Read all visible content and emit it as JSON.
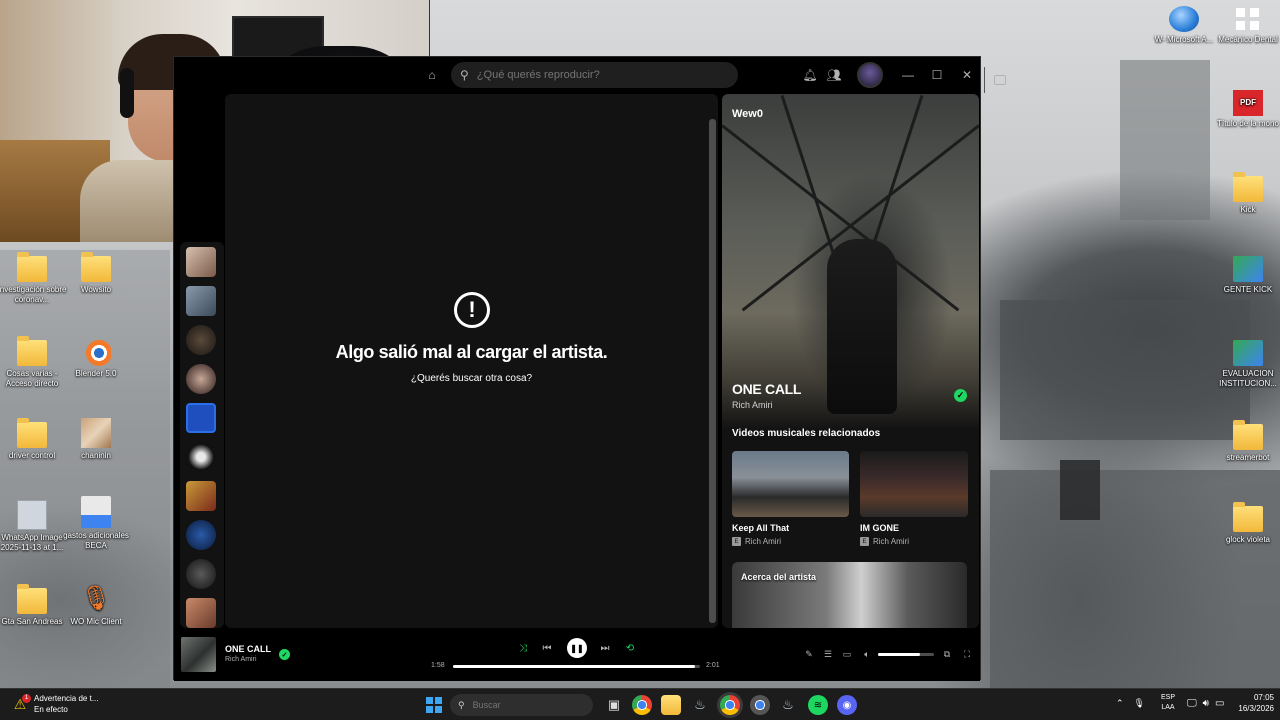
{
  "desktop": {
    "icons": [
      {
        "label": "Investigación sobre coronav..."
      },
      {
        "label": "Wowsito"
      },
      {
        "label": "Cosas varias - Acceso directo"
      },
      {
        "label": "Blender 5.0"
      },
      {
        "label": "driver control"
      },
      {
        "label": "chaninin"
      },
      {
        "label": "WhatsApp Image 2025-11-13 at 1..."
      },
      {
        "label": "gastos adicionales BECA"
      },
      {
        "label": "Gta San Andreas"
      },
      {
        "label": "WO Mic Client"
      },
      {
        "label": "W- Microsoft A..."
      },
      {
        "label": "Mecánico Dental"
      },
      {
        "label": "Título de la mono"
      },
      {
        "label": "Kick"
      },
      {
        "label": "GENTE KICK"
      },
      {
        "label": "EVALUACION INSTITUCION..."
      },
      {
        "label": "streamerbot"
      },
      {
        "label": "glock violeta"
      }
    ]
  },
  "spotify": {
    "search_placeholder": "¿Qué querés reproducir?",
    "error": {
      "icon": "!",
      "title": "Algo salió mal al cargar el artista.",
      "subtitle": "¿Querés buscar otra cosa?"
    },
    "right_panel": {
      "header": "Wew0",
      "song_title": "ONE CALL",
      "artist": "Rich Amiri",
      "related_heading": "Videos musicales relacionados",
      "related": [
        {
          "title": "Keep All That",
          "artist": "Rich Amiri"
        },
        {
          "title": "IM GONE",
          "artist": "Rich Amiri"
        }
      ],
      "explicit_badge": "E",
      "about_label": "Acerca del artista"
    },
    "player": {
      "title": "ONE CALL",
      "artist": "Rich Amiri",
      "current_time": "1:58",
      "total_time": "2:01",
      "progress": 0.98,
      "volume": 0.75
    }
  },
  "taskbar": {
    "warning_badge": "1",
    "warning_title": "Advertencia de t...",
    "warning_status": "En efecto",
    "search_placeholder": "Buscar",
    "lang_line1": "ESP",
    "lang_line2": "LAA",
    "time": "07:05",
    "date": "16/3/2026"
  }
}
